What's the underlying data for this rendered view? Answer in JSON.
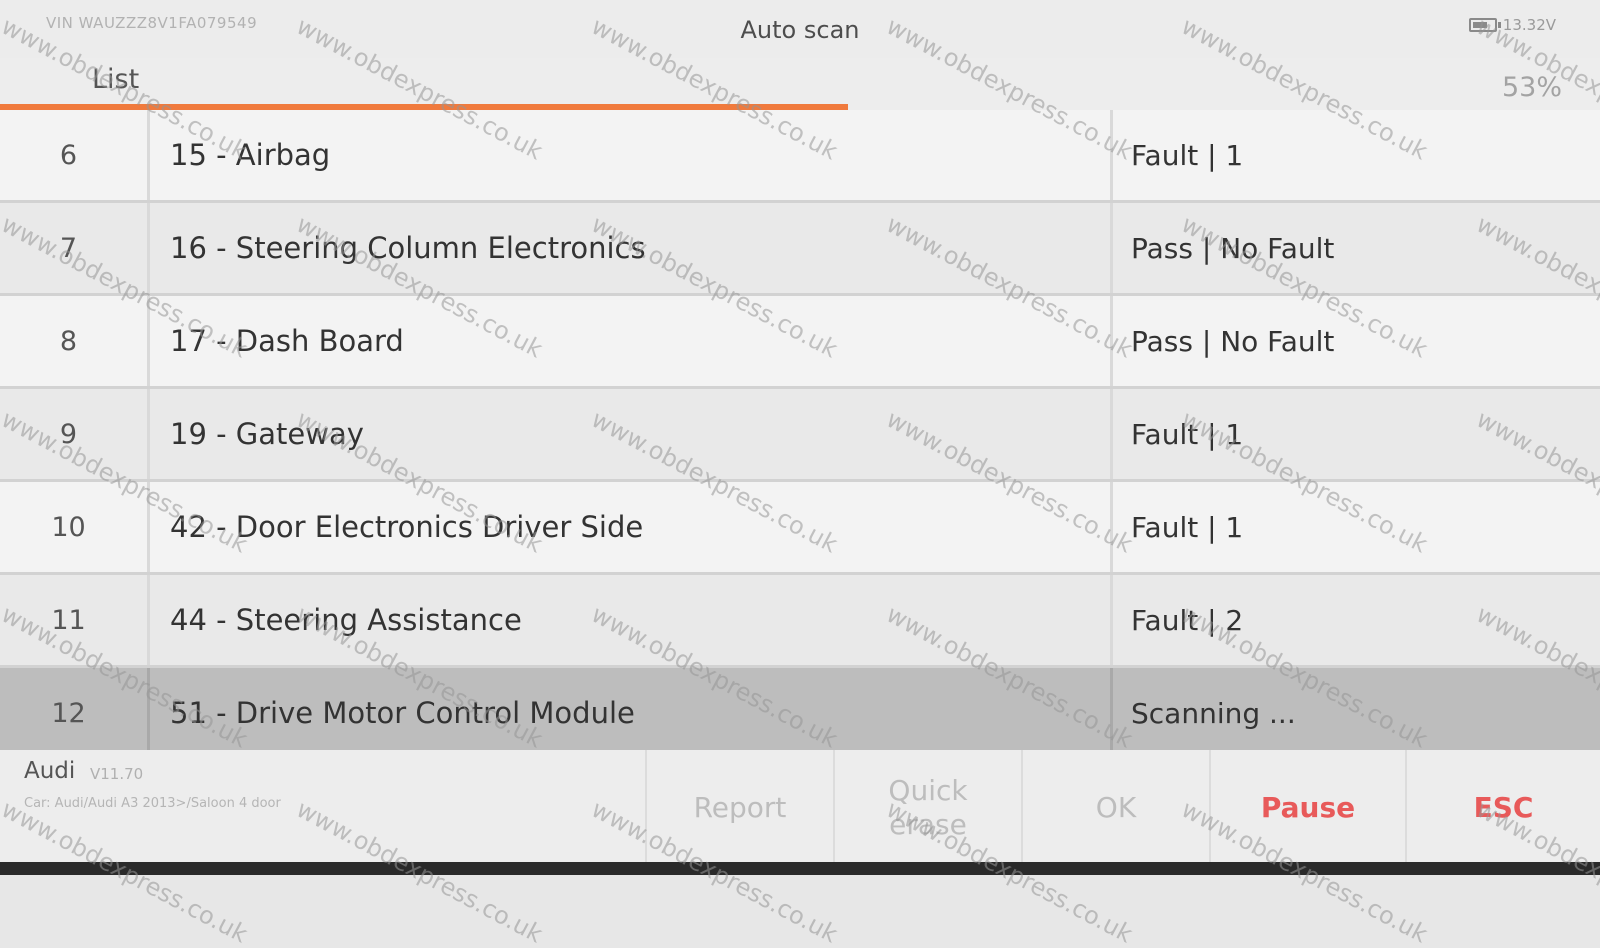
{
  "header": {
    "vin": "VIN WAUZZZ8V1FA079549",
    "title": "Auto scan",
    "battery_voltage": "13.32V"
  },
  "subheader": {
    "list_label": "List",
    "progress_text": "53%",
    "progress_value": 0.53,
    "progress_color": "#f07a3d"
  },
  "rows": [
    {
      "num": "6",
      "name": "15 - Airbag",
      "status": "Fault | 1"
    },
    {
      "num": "7",
      "name": "16 - Steering Column Electronics",
      "status": "Pass | No Fault"
    },
    {
      "num": "8",
      "name": "17 - Dash Board",
      "status": "Pass | No Fault"
    },
    {
      "num": "9",
      "name": "19 - Gateway",
      "status": "Fault | 1"
    },
    {
      "num": "10",
      "name": "42 - Door Electronics Driver Side",
      "status": "Fault | 1"
    },
    {
      "num": "11",
      "name": "44 - Steering Assistance",
      "status": "Fault | 2"
    },
    {
      "num": "12",
      "name": "51 - Drive Motor Control Module",
      "status": "Scanning ..."
    }
  ],
  "footer": {
    "brand": "Audi",
    "version": "V11.70",
    "car": "Car: Audi/Audi A3 2013>/Saloon 4 door",
    "buttons": {
      "report": "Report",
      "quick_erase": "Quick erase",
      "ok": "OK",
      "pause": "Pause",
      "esc": "ESC"
    }
  },
  "watermark_text": "www.obdexpress.co.uk"
}
